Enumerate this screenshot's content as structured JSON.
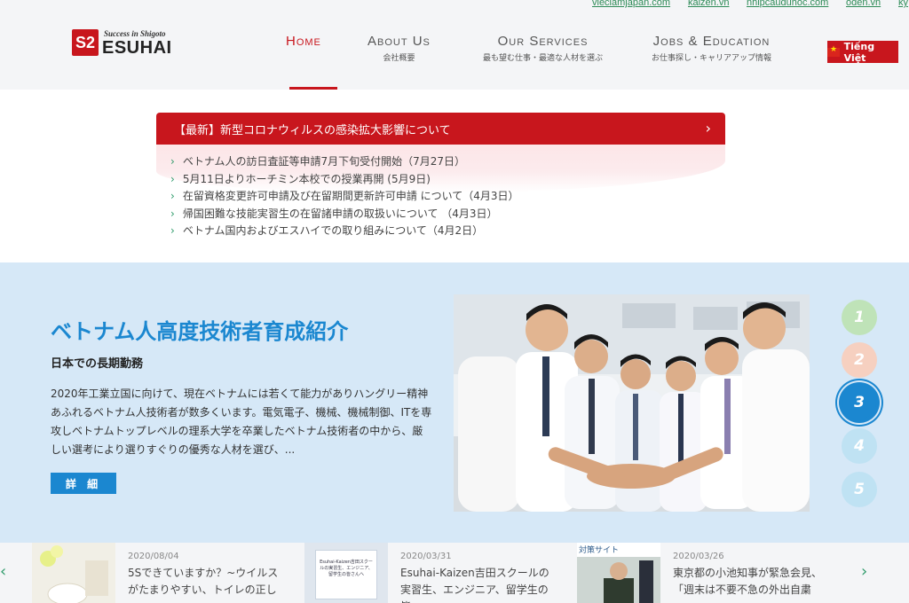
{
  "top_links": [
    "vieclamjapan.com",
    "kaizen.vn",
    "nhipcauduhoc.com",
    "oden.vn",
    "ky"
  ],
  "logo": {
    "tagline": "Success in Shigoto",
    "name": "ESUHAI",
    "mark": "S2"
  },
  "nav": [
    {
      "title": "Home",
      "sub": ""
    },
    {
      "title": "About Us",
      "sub": "会社概要"
    },
    {
      "title": "Our Services",
      "sub": "最も望む仕事・最適な人材を選ぶ"
    },
    {
      "title": "Jobs & Education",
      "sub": "お仕事探し・キャリアアップ情報"
    }
  ],
  "language_button": "Tiếng Việt",
  "news": {
    "headline": "【最新】新型コロナウィルスの感染拡大影響について",
    "items": [
      "ベトナム人の訪日査証等申請7月下旬受付開始（7月27日）",
      "5月11日よりホーチミン本校での授業再開 (5月9日)",
      "在留資格変更許可申請及び在留期間更新許可申請 について（4月3日）",
      "帰国困難な技能実習生の在留諸申請の取扱いについて （4月3日）",
      "ベトナム国内およびエスハイでの取り組みについて（4月2日）"
    ]
  },
  "hero": {
    "title": "ベトナム人高度技術者育成紹介",
    "subtitle": "日本での長期勤務",
    "body": "2020年工業立国に向けて、現在ベトナムには若くて能力がありハングリー精神あふれるベトナム人技術者が数多くいます。電気電子、機械、機械制御、ITを専攻しベトナムトップレベルの理系大学を卒業したベトナム技術者の中から、厳しい選考により選りすぐりの優秀な人材を選び、...",
    "button": "詳 細",
    "slides": [
      "1",
      "2",
      "3",
      "4",
      "5"
    ],
    "active_slide": 3
  },
  "articles": [
    {
      "date": "2020/08/04",
      "title": "5Sできていますか？~ウイルスがたまりやすい、トイレの正し"
    },
    {
      "date": "2020/03/31",
      "title": "Esuhai-Kaizen吉田スクールの実習生、エンジニア、留学生の皆"
    },
    {
      "date": "2020/03/26",
      "title": "東京都の小池知事が緊急会見、「週末は不要不急の外出自粛"
    }
  ],
  "thumb_text": {
    "poster": "Esuhai-Kaizen吉田スクールの実習生、エンジニア、留学生の皆さんへ",
    "sign": "対策サイト"
  },
  "strip_arrows": {
    "prev": "‹",
    "next": "›"
  },
  "colors": {
    "brand_red": "#c8161d",
    "accent_blue": "#1b87d0",
    "link_green": "#2e9b6a",
    "hero_bg": "#d6e8f7"
  }
}
